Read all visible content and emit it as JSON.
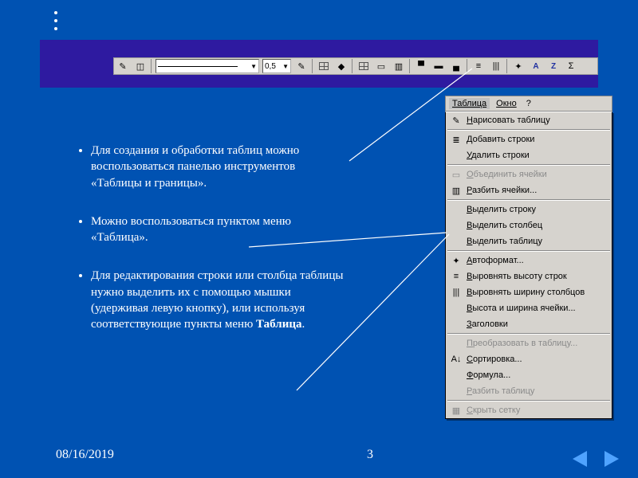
{
  "toolbar": {
    "line_width": "0,5"
  },
  "bullets": [
    "Для создания и обработки таблиц можно воспользоваться панелью инструментов «Таблицы и границы».",
    "Можно воспользоваться пунктом меню «Таблица».",
    "Для редактирования строки или столбца таблицы нужно выделить их с помощью мышки (удерживая левую кнопку), или используя соответствующие пункты меню "
  ],
  "bullet3_bold": "Таблица",
  "bullet3_tail": ".",
  "menubar": {
    "active": "Таблица",
    "items": [
      "Окно",
      "?"
    ]
  },
  "menu": {
    "groups": [
      [
        {
          "label": "Нарисовать таблицу",
          "icon": "pencil-icon"
        }
      ],
      [
        {
          "label": "Добавить строки",
          "icon": "insert-rows-icon"
        },
        {
          "label": "Удалить строки",
          "icon": ""
        }
      ],
      [
        {
          "label": "Объединить ячейки",
          "icon": "merge-icon",
          "disabled": true
        },
        {
          "label": "Разбить ячейки...",
          "icon": "split-icon"
        }
      ],
      [
        {
          "label": "Выделить строку",
          "icon": ""
        },
        {
          "label": "Выделить столбец",
          "icon": ""
        },
        {
          "label": "Выделить таблицу",
          "icon": ""
        }
      ],
      [
        {
          "label": "Автоформат...",
          "icon": "autoformat-icon"
        },
        {
          "label": "Выровнять высоту строк",
          "icon": "dist-rows-icon"
        },
        {
          "label": "Выровнять ширину столбцов",
          "icon": "dist-cols-icon"
        },
        {
          "label": "Высота и ширина ячейки...",
          "icon": ""
        },
        {
          "label": "Заголовки",
          "icon": ""
        }
      ],
      [
        {
          "label": "Преобразовать в таблицу...",
          "icon": "",
          "disabled": true
        },
        {
          "label": "Сортировка...",
          "icon": "sort-icon"
        },
        {
          "label": "Формула...",
          "icon": ""
        },
        {
          "label": "Разбить таблицу",
          "icon": "",
          "disabled": true
        }
      ],
      [
        {
          "label": "Скрыть сетку",
          "icon": "grid-icon",
          "disabled": true
        }
      ]
    ]
  },
  "footer": {
    "date": "08/16/2019",
    "page": "3"
  }
}
